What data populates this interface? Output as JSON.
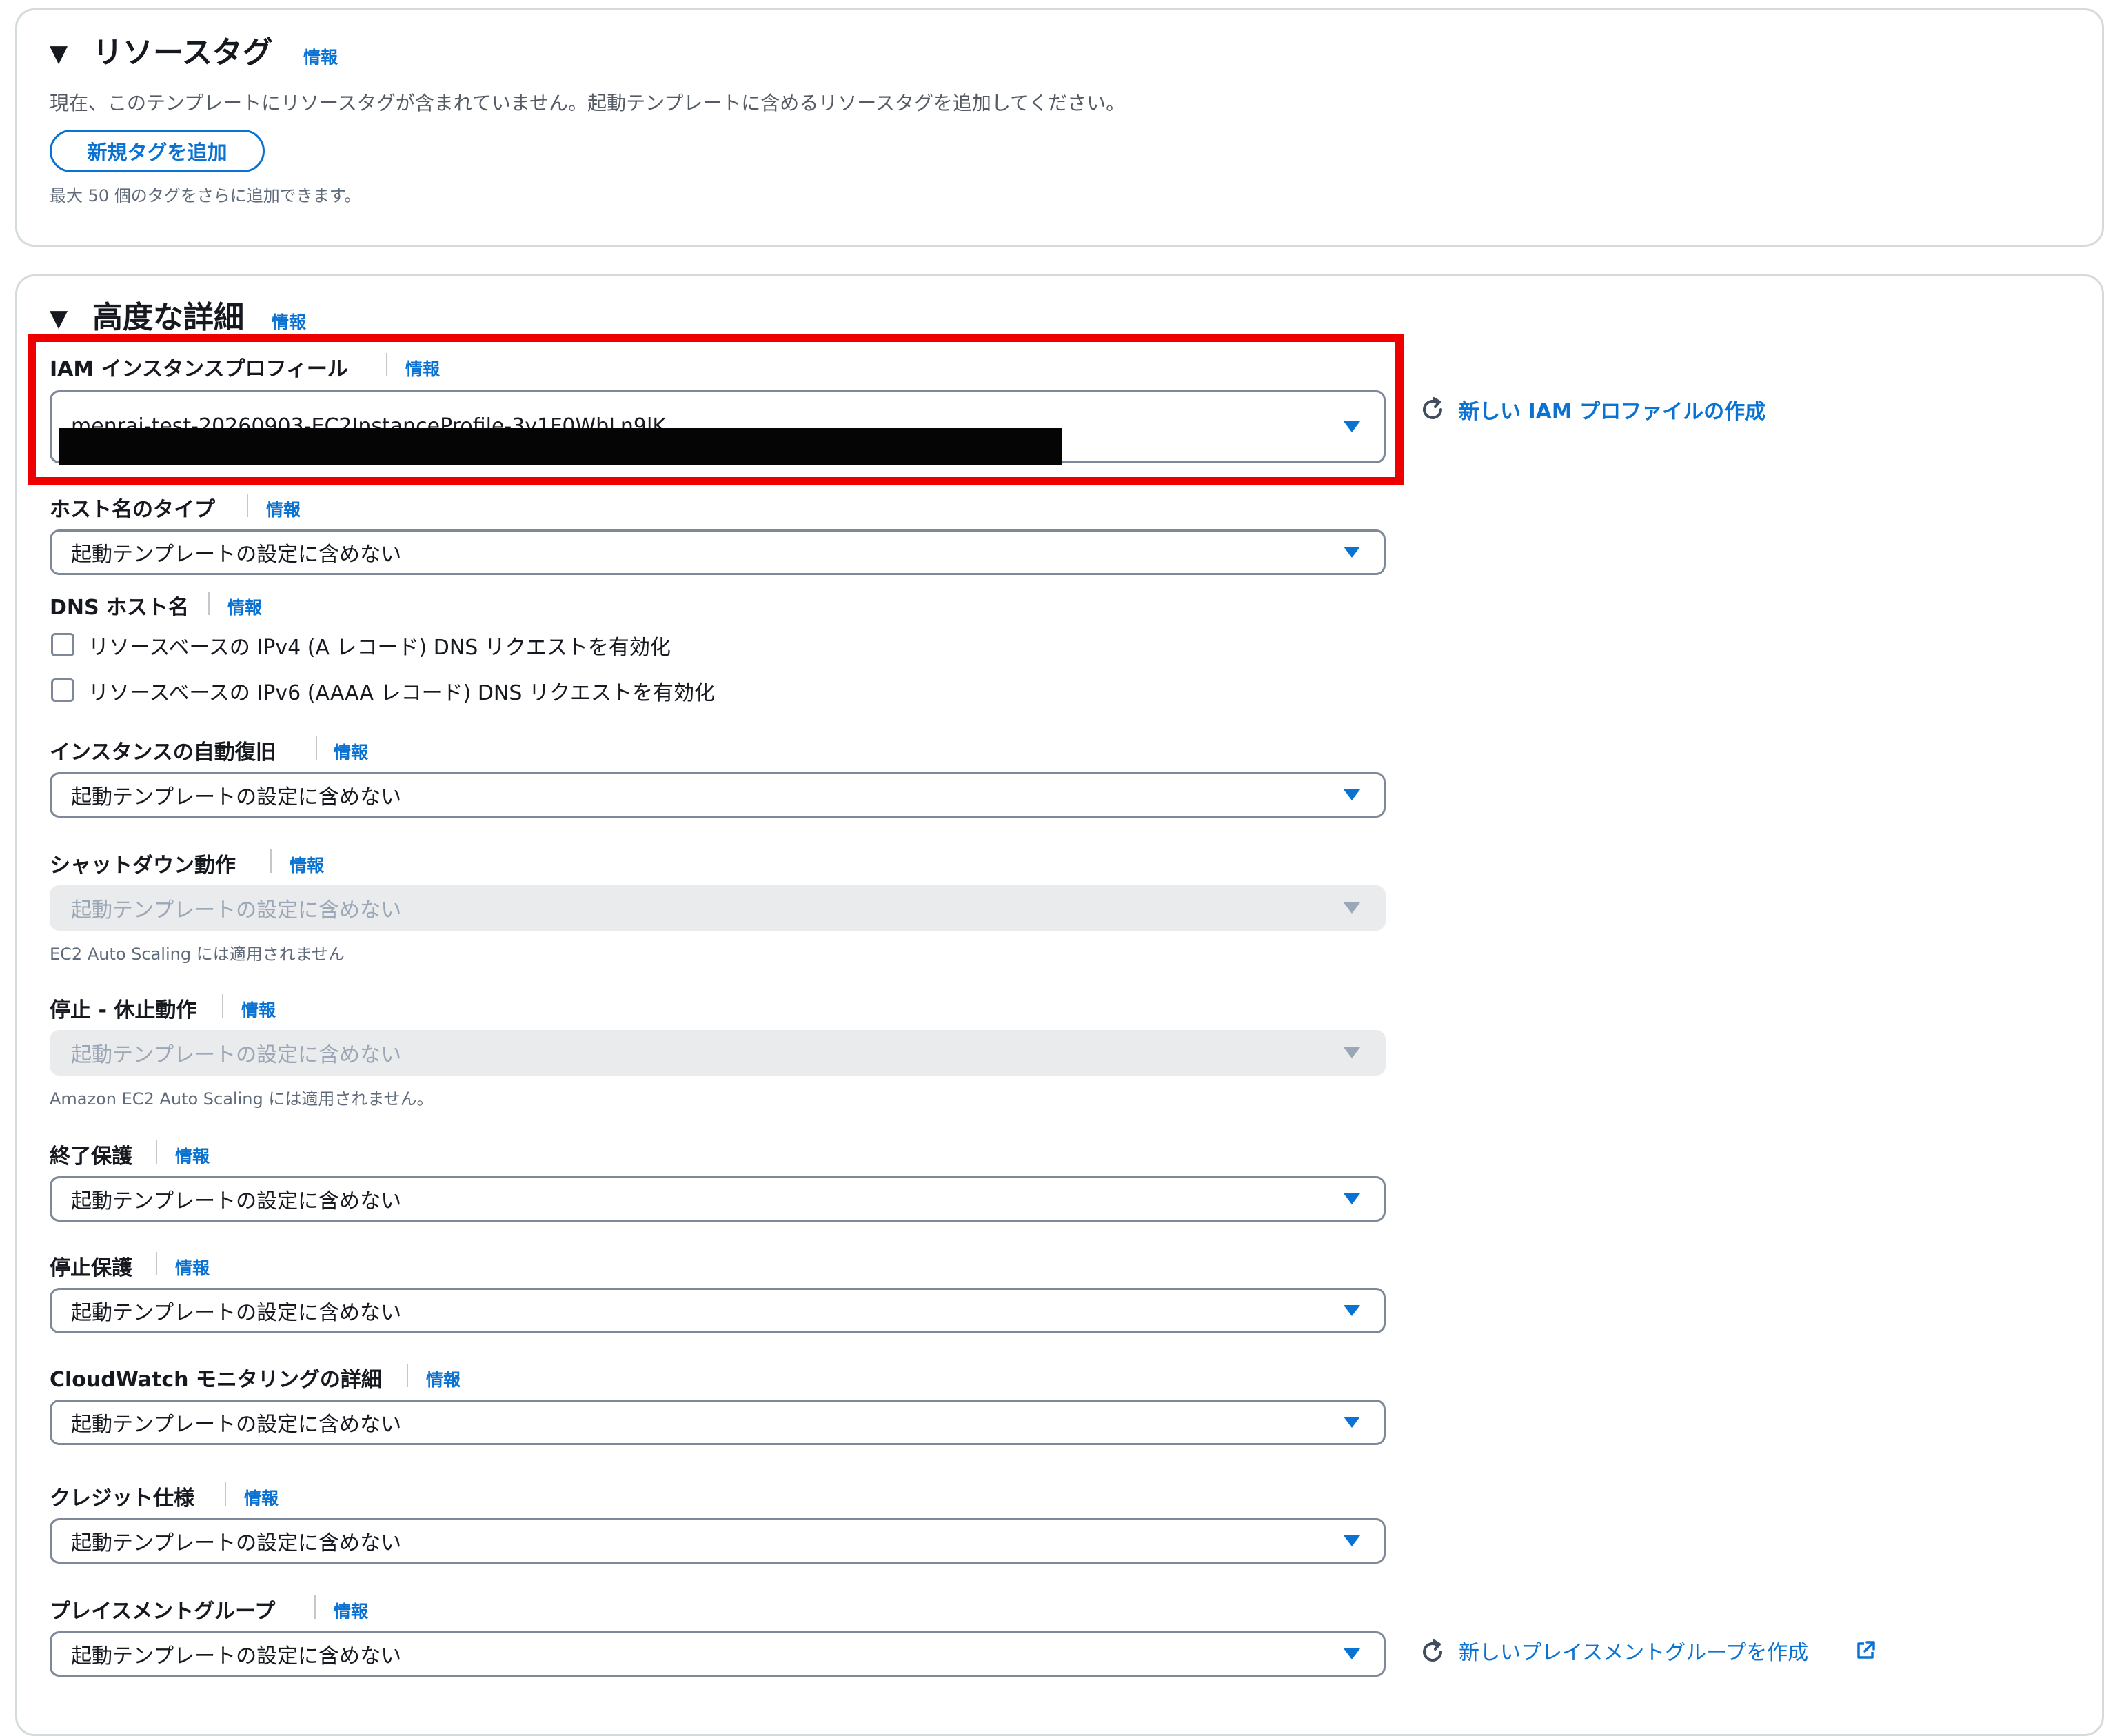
{
  "resource_tags": {
    "title": "リソースタグ",
    "info": "情報",
    "description": "現在、このテンプレートにリソースタグが含まれていません。起動テンプレートに含めるリソースタグを追加してください。",
    "add_button": "新規タグを追加",
    "hint": "最大 50 個のタグをさらに追加できます。"
  },
  "advanced": {
    "title": "高度な詳細",
    "info": "情報",
    "iam_profile": {
      "label": "IAM インスタンスプロフィール",
      "info": "情報",
      "value": "menrai-test-20260903-EC2InstanceProfile-3y1F0WbLn9lK",
      "create_link": "新しい IAM プロファイルの作成"
    },
    "hostname_type": {
      "label": "ホスト名のタイプ",
      "info": "情報",
      "value": "起動テンプレートの設定に含めない"
    },
    "dns_hostname": {
      "label": "DNS ホスト名",
      "info": "情報",
      "options": [
        {
          "label": "リソースベースの IPv4 (A レコード) DNS リクエストを有効化",
          "checked": false
        },
        {
          "label": "リソースベースの IPv6 (AAAA レコード) DNS リクエストを有効化",
          "checked": false
        }
      ]
    },
    "auto_recovery": {
      "label": "インスタンスの自動復旧",
      "info": "情報",
      "value": "起動テンプレートの設定に含めない"
    },
    "shutdown_behavior": {
      "label": "シャットダウン動作",
      "info": "情報",
      "value": "起動テンプレートの設定に含めない",
      "disabled": true,
      "hint": "EC2 Auto Scaling には適用されません"
    },
    "stop_hibernate": {
      "label": "停止 - 休止動作",
      "info": "情報",
      "value": "起動テンプレートの設定に含めない",
      "disabled": true,
      "hint": "Amazon EC2 Auto Scaling には適用されません。"
    },
    "termination_protection": {
      "label": "終了保護",
      "info": "情報",
      "value": "起動テンプレートの設定に含めない"
    },
    "stop_protection": {
      "label": "停止保護",
      "info": "情報",
      "value": "起動テンプレートの設定に含めない"
    },
    "cloudwatch": {
      "label": "CloudWatch モニタリングの詳細",
      "info": "情報",
      "value": "起動テンプレートの設定に含めない"
    },
    "credit_spec": {
      "label": "クレジット仕様",
      "info": "情報",
      "value": "起動テンプレートの設定に含めない"
    },
    "placement_group": {
      "label": "プレイスメントグループ",
      "info": "情報",
      "value": "起動テンプレートの設定に含めない",
      "create_link": "新しいプレイスメントグループを作成"
    }
  },
  "colors": {
    "link": "#0972d3",
    "highlight": "#ee0000",
    "border": "#7d8998"
  }
}
